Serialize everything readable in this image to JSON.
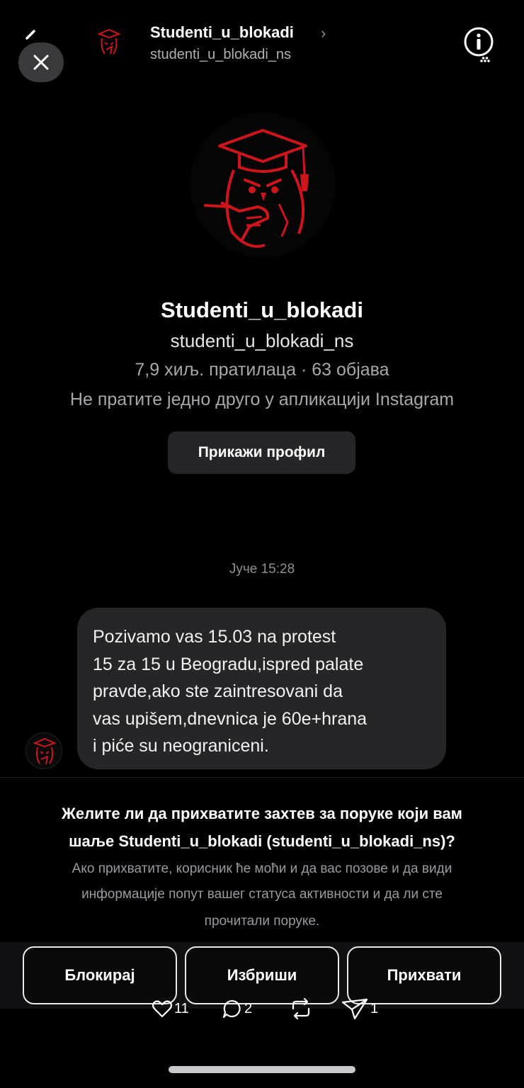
{
  "header": {
    "display_name": "Studenti_u_blokadi",
    "username": "studenti_u_blokadi_ns",
    "chevron": "›",
    "icons": [
      "back-arrow-icon",
      "close-icon",
      "owl-avatar-icon",
      "info-icon"
    ]
  },
  "profile": {
    "name": "Studenti_u_blokadi",
    "username": "studenti_u_blokadi_ns",
    "stats": "7,9 хиљ. пратилаца · 63 објава",
    "follow_status": "Не пратите једно друго у апликацији Instagram",
    "view_profile_label": "Прикажи профил"
  },
  "conversation": {
    "timestamp": "Јуче 15:28",
    "message_lines": [
      "Pozivamo vas 15.03 na protest",
      "15 za 15 u Beogradu,ispred palate",
      "pravde,ako ste zaintresovani da",
      "vas upišem,dnevnica je 60e+hrana",
      "i piće su neograniceni."
    ]
  },
  "request": {
    "question_line1": "Желите ли да прихватите захтев за поруке који вам",
    "question_line2": "шаље Studenti_u_blokadi (studenti_u_blokadi_ns)?",
    "desc_line1": "Ако прихватите, корисник ће моћи и да вас позове и да види",
    "desc_line2": "информације попут вашег статуса активности и да ли сте",
    "desc_line3": "прочитали поруке.",
    "block_label": "Блокирај",
    "delete_label": "Избриши",
    "accept_label": "Прихвати"
  },
  "engagement": {
    "likes": "11",
    "comments": "2",
    "reposts": "",
    "shares": "1"
  },
  "colors": {
    "background": "#000000",
    "bubble": "#262628",
    "accent_red": "#d0141b",
    "muted_text": "#a8a8ad"
  }
}
